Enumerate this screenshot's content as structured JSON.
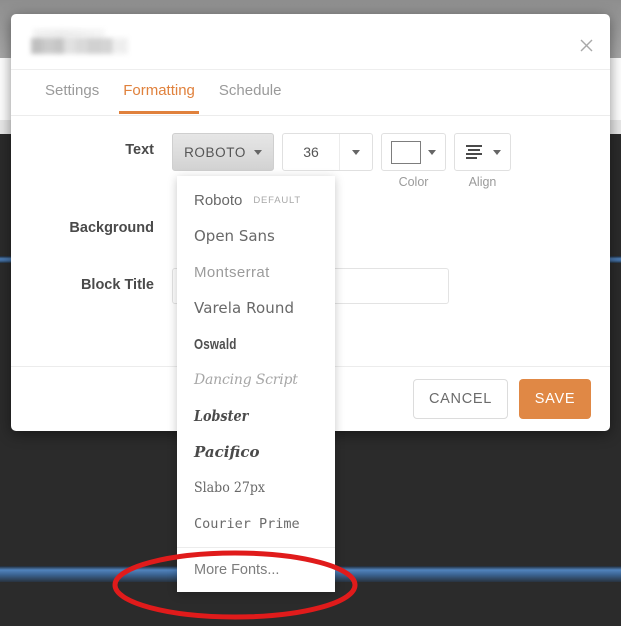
{
  "window": {
    "title_redacted": true,
    "close_icon": "close-icon"
  },
  "tabs": [
    {
      "label": "Settings",
      "active": false
    },
    {
      "label": "Formatting",
      "active": true
    },
    {
      "label": "Schedule",
      "active": false
    }
  ],
  "form": {
    "rows": [
      {
        "label": "Text"
      },
      {
        "label": "Background"
      },
      {
        "label": "Block Title"
      }
    ],
    "text_controls": {
      "font_button_label": "ROBOTO",
      "font_size_value": "36",
      "color_caption": "Color",
      "align_caption": "Align",
      "color_swatch_hex": "#ffffff"
    },
    "block_title_value": "",
    "block_title_placeholder": ""
  },
  "footer": {
    "cancel_label": "CANCEL",
    "save_label": "SAVE"
  },
  "font_dropdown": {
    "items": [
      {
        "name": "Roboto",
        "tag": "DEFAULT"
      },
      {
        "name": "Open Sans",
        "tag": ""
      },
      {
        "name": "Montserrat",
        "tag": ""
      },
      {
        "name": "Varela Round",
        "tag": ""
      },
      {
        "name": "Oswald",
        "tag": ""
      },
      {
        "name": "Dancing Script",
        "tag": ""
      },
      {
        "name": "Lobster",
        "tag": ""
      },
      {
        "name": "Pacifico",
        "tag": ""
      },
      {
        "name": "Slabo 27px",
        "tag": ""
      },
      {
        "name": "Courier Prime",
        "tag": ""
      }
    ],
    "more_label": "More Fonts..."
  },
  "annotation": {
    "shape": "ellipse",
    "color": "#e01b1b",
    "target": "More Fonts..."
  },
  "colors": {
    "accent": "#e0813c",
    "save_button": "#e08845",
    "backdrop": "#2b2b2b",
    "annotation_red": "#e01b1b",
    "band_blue": "#5183bd"
  }
}
